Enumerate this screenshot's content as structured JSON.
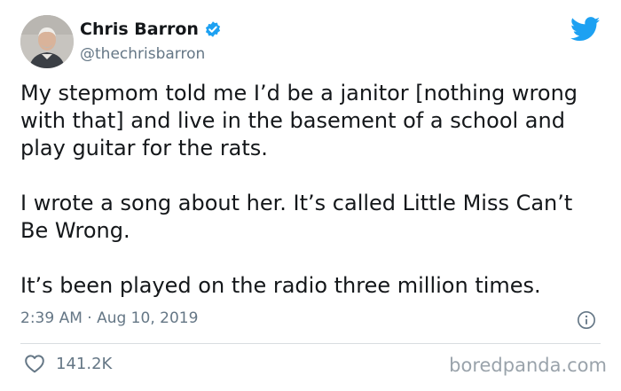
{
  "author": {
    "name": "Chris Barron",
    "handle": "@thechrisbarron",
    "verified": true,
    "verified_badge_color": "#1da1f2"
  },
  "tweet": {
    "paragraphs": [
      "My stepmom told me I’d be a janitor [nothing wrong with that] and live in the basement of a school and play guitar for the rats.",
      "I wrote a song about her. It’s called Little Miss Can’t Be Wrong.",
      "It’s been played on the radio three million times."
    ],
    "timestamp": "2:39 AM · Aug 10, 2019",
    "likes": "141.2K"
  },
  "watermark": "boredpanda.com",
  "icons": {
    "brand": "twitter-bird-icon",
    "info": "info-icon",
    "like": "heart-icon"
  },
  "colors": {
    "twitter_blue": "#1da1f2",
    "secondary_text": "#657786",
    "primary_text": "#14171a"
  }
}
